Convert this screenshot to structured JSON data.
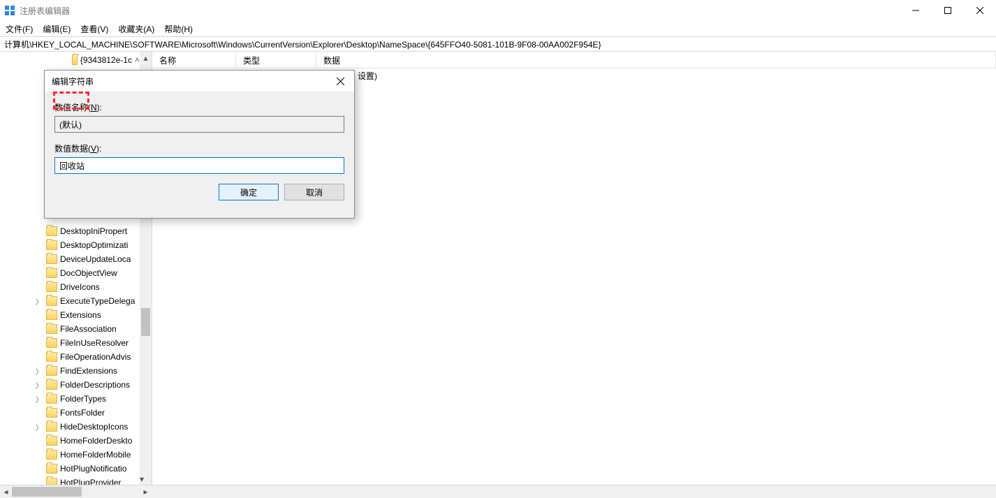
{
  "window": {
    "title": "注册表编辑器"
  },
  "menu": {
    "file": "文件(F)",
    "edit": "编辑(E)",
    "view": "查看(V)",
    "favorites": "收藏夹(A)",
    "help": "帮助(H)"
  },
  "address": "计算机\\HKEY_LOCAL_MACHINE\\SOFTWARE\\Microsoft\\Windows\\CurrentVersion\\Explorer\\Desktop\\NameSpace\\{645FFO40-5081-101B-9F08-00AA002F954E}",
  "tree": {
    "top_item": "{9343812e-1c",
    "items": [
      {
        "label": "DesktopIniPropert",
        "exp": false
      },
      {
        "label": "DesktopOptimizati",
        "exp": false
      },
      {
        "label": "DeviceUpdateLoca",
        "exp": false
      },
      {
        "label": "DocObjectView",
        "exp": false
      },
      {
        "label": "DriveIcons",
        "exp": false
      },
      {
        "label": "ExecuteTypeDelega",
        "exp": true
      },
      {
        "label": "Extensions",
        "exp": false
      },
      {
        "label": "FileAssociation",
        "exp": false
      },
      {
        "label": "FileInUseResolver",
        "exp": false
      },
      {
        "label": "FileOperationAdvis",
        "exp": false
      },
      {
        "label": "FindExtensions",
        "exp": true
      },
      {
        "label": "FolderDescriptions",
        "exp": true
      },
      {
        "label": "FolderTypes",
        "exp": true
      },
      {
        "label": "FontsFolder",
        "exp": false
      },
      {
        "label": "HideDesktopIcons",
        "exp": true
      },
      {
        "label": "HomeFolderDeskto",
        "exp": false
      },
      {
        "label": "HomeFolderMobile",
        "exp": false
      },
      {
        "label": "HotPlugNotificatio",
        "exp": false
      },
      {
        "label": "HotPlugProvider",
        "exp": false
      }
    ]
  },
  "list": {
    "columns": {
      "name": "名称",
      "type": "类型",
      "data": "数据"
    },
    "row_partial_data": "设置)"
  },
  "dialog": {
    "title": "编辑字符串",
    "name_label_prefix": "数值名称(",
    "name_label_key": "N",
    "name_label_suffix": "):",
    "name_value": "(默认)",
    "data_label_prefix": "数值数据(",
    "data_label_key": "V",
    "data_label_suffix": "):",
    "data_value": "回收站",
    "ok": "确定",
    "cancel": "取消"
  }
}
